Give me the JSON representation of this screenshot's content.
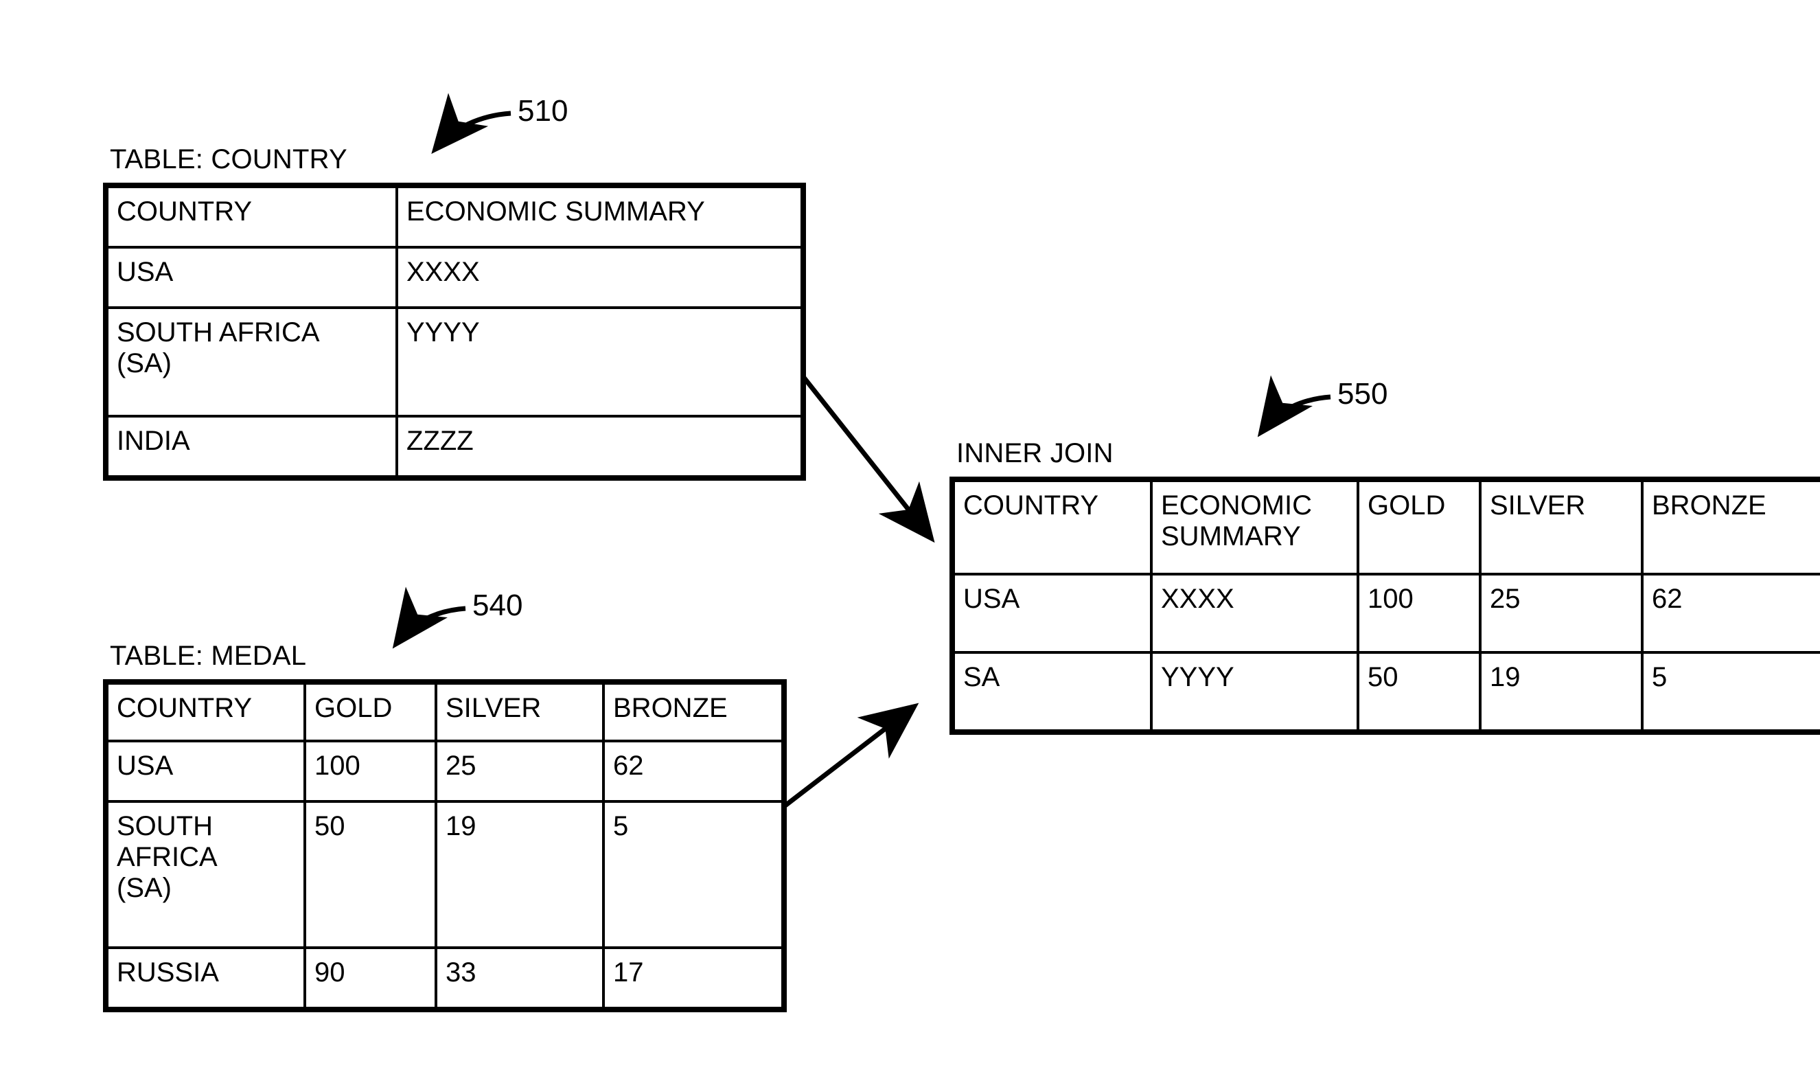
{
  "figure": {
    "background": "#ffffff",
    "ink": "#000000"
  },
  "country_table": {
    "caption": "TABLE: COUNTRY",
    "ref": "510",
    "columns": [
      "COUNTRY",
      "ECONOMIC SUMMARY"
    ],
    "rows": [
      [
        "USA",
        "XXXX"
      ],
      [
        "SOUTH AFRICA\n(SA)",
        "YYYY"
      ],
      [
        "INDIA",
        "ZZZZ"
      ]
    ]
  },
  "medal_table": {
    "caption": "TABLE: MEDAL",
    "ref": "540",
    "columns": [
      "COUNTRY",
      "GOLD",
      "SILVER",
      "BRONZE"
    ],
    "rows": [
      [
        "USA",
        "100",
        "25",
        "62"
      ],
      [
        "SOUTH\nAFRICA\n(SA)",
        "50",
        "19",
        "5"
      ],
      [
        "RUSSIA",
        "90",
        "33",
        "17"
      ]
    ]
  },
  "join_table": {
    "caption": "INNER JOIN",
    "ref": "550",
    "columns": [
      "COUNTRY",
      "ECONOMIC\nSUMMARY",
      "GOLD",
      "SILVER",
      "BRONZE"
    ],
    "rows": [
      [
        "USA",
        "XXXX",
        "100",
        "25",
        "62"
      ],
      [
        "SA",
        "YYYY",
        "50",
        "19",
        "5"
      ]
    ]
  }
}
